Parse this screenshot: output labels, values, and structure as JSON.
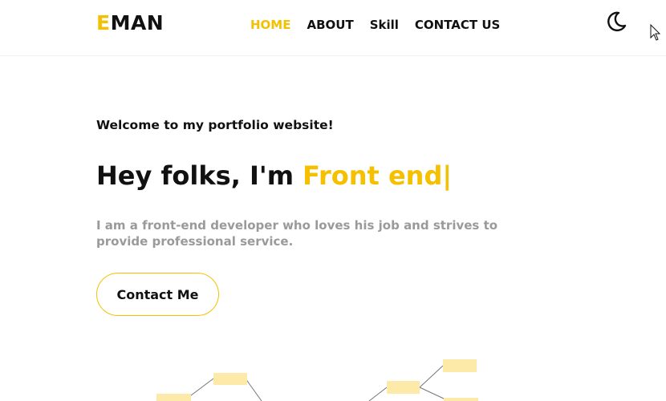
{
  "brand": {
    "first_letter": "E",
    "rest": "MAN"
  },
  "nav": {
    "items": [
      {
        "label": "HOME",
        "active": true
      },
      {
        "label": "ABOUT",
        "active": false
      },
      {
        "label": "Skill",
        "active": false
      },
      {
        "label": "CONTACT US",
        "active": false
      }
    ]
  },
  "theme_toggle": {
    "icon": "moon-icon"
  },
  "hero": {
    "welcome": "Welcome to my portfolio website!",
    "heading_prefix": "Hey folks, I'm ",
    "heading_typed": "Front end|",
    "description": "I am a front-end developer who loves his job and strives to provide professional service.",
    "cta_label": "Contact Me"
  },
  "colors": {
    "accent": "#f5c000",
    "muted_text": "#9a9a9a",
    "tree_node": "#fde9a8"
  }
}
